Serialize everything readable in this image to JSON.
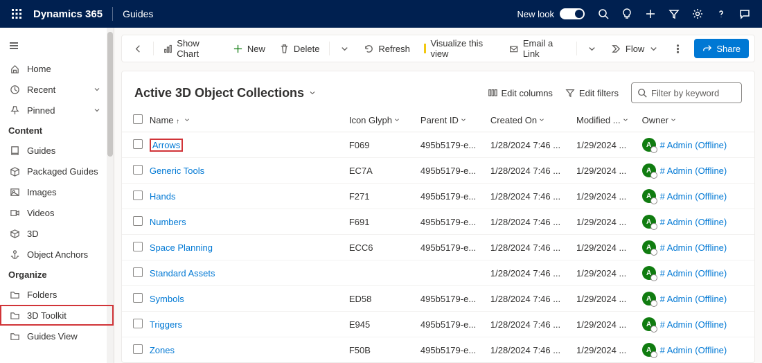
{
  "header": {
    "brand": "Dynamics 365",
    "product": "Guides",
    "newlook_label": "New look"
  },
  "sidebar": {
    "top": [
      {
        "label": "Home",
        "icon": "home"
      },
      {
        "label": "Recent",
        "icon": "clock",
        "chevron": true
      },
      {
        "label": "Pinned",
        "icon": "pin",
        "chevron": true
      }
    ],
    "groups": [
      {
        "title": "Content",
        "items": [
          {
            "label": "Guides",
            "icon": "book"
          },
          {
            "label": "Packaged Guides",
            "icon": "box"
          },
          {
            "label": "Images",
            "icon": "image"
          },
          {
            "label": "Videos",
            "icon": "video"
          },
          {
            "label": "3D",
            "icon": "cube"
          },
          {
            "label": "Object Anchors",
            "icon": "anchor"
          }
        ]
      },
      {
        "title": "Organize",
        "items": [
          {
            "label": "Folders",
            "icon": "folder"
          },
          {
            "label": "3D Toolkit",
            "icon": "folder",
            "highlight": true
          },
          {
            "label": "Guides View",
            "icon": "folder"
          }
        ]
      }
    ]
  },
  "commandbar": {
    "show_chart": "Show Chart",
    "new": "New",
    "delete": "Delete",
    "refresh": "Refresh",
    "visualize": "Visualize this view",
    "email": "Email a Link",
    "flow": "Flow",
    "share": "Share"
  },
  "view": {
    "title": "Active 3D Object Collections",
    "edit_columns": "Edit columns",
    "edit_filters": "Edit filters",
    "search_placeholder": "Filter by keyword"
  },
  "columns": {
    "name": "Name",
    "icon": "Icon Glyph",
    "parent": "Parent ID",
    "created": "Created On",
    "modified": "Modified ...",
    "owner": "Owner"
  },
  "owner_label": "# Admin (Offline)",
  "avatar_initial": "A",
  "rows": [
    {
      "name": "Arrows",
      "icon": "F069",
      "parent": "495b5179-e...",
      "created": "1/28/2024 7:46 ...",
      "modified": "1/29/2024 ...",
      "highlight": true
    },
    {
      "name": "Generic Tools",
      "icon": "EC7A",
      "parent": "495b5179-e...",
      "created": "1/28/2024 7:46 ...",
      "modified": "1/29/2024 ..."
    },
    {
      "name": "Hands",
      "icon": "F271",
      "parent": "495b5179-e...",
      "created": "1/28/2024 7:46 ...",
      "modified": "1/29/2024 ..."
    },
    {
      "name": "Numbers",
      "icon": "F691",
      "parent": "495b5179-e...",
      "created": "1/28/2024 7:46 ...",
      "modified": "1/29/2024 ..."
    },
    {
      "name": "Space Planning",
      "icon": "ECC6",
      "parent": "495b5179-e...",
      "created": "1/28/2024 7:46 ...",
      "modified": "1/29/2024 ..."
    },
    {
      "name": "Standard Assets",
      "icon": "",
      "parent": "",
      "created": "1/28/2024 7:46 ...",
      "modified": "1/29/2024 ..."
    },
    {
      "name": "Symbols",
      "icon": "ED58",
      "parent": "495b5179-e...",
      "created": "1/28/2024 7:46 ...",
      "modified": "1/29/2024 ..."
    },
    {
      "name": "Triggers",
      "icon": "E945",
      "parent": "495b5179-e...",
      "created": "1/28/2024 7:46 ...",
      "modified": "1/29/2024 ..."
    },
    {
      "name": "Zones",
      "icon": "F50B",
      "parent": "495b5179-e...",
      "created": "1/28/2024 7:46 ...",
      "modified": "1/29/2024 ..."
    }
  ]
}
